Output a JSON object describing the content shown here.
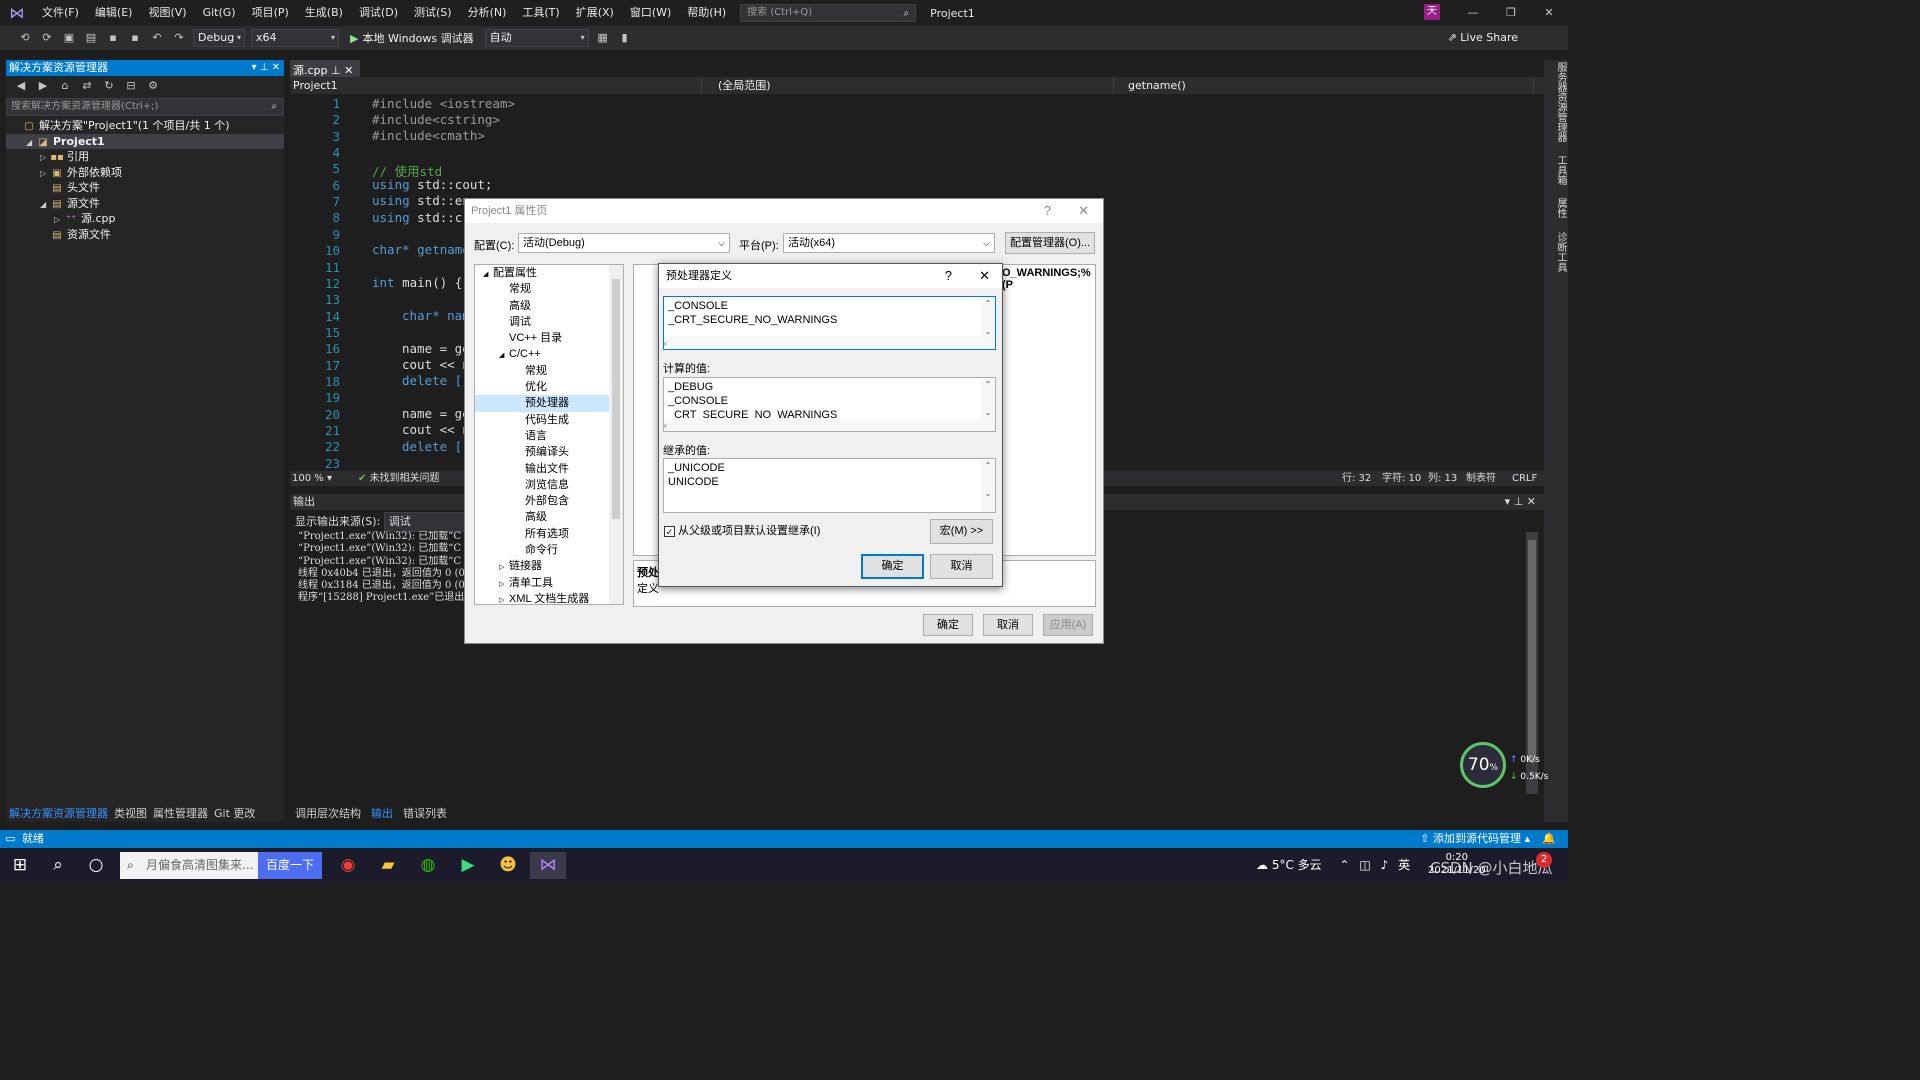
{
  "titlebar": {
    "menu": [
      "文件(F)",
      "编辑(E)",
      "视图(V)",
      "Git(G)",
      "项目(P)",
      "生成(B)",
      "调试(D)",
      "测试(S)",
      "分析(N)",
      "工具(T)",
      "扩展(X)",
      "窗口(W)",
      "帮助(H)"
    ],
    "search_placeholder": "搜索 (Ctrl+Q)",
    "project": "Project1",
    "avatar": "天",
    "win_min": "—",
    "win_max": "❐",
    "win_close": "✕"
  },
  "toolbar": {
    "config": "Debug",
    "platform": "x64",
    "run": "本地 Windows 调试器",
    "auto": "自动",
    "liveshare": "Live Share"
  },
  "solution": {
    "title": "解决方案资源管理器",
    "search_placeholder": "搜索解决方案资源管理器(Ctrl+;)",
    "items": [
      {
        "label": "解决方案\"Project1\"(1 个项目/共 1 个)",
        "depth": 0,
        "arrow": ""
      },
      {
        "label": "Project1",
        "depth": 1,
        "arrow": "◢"
      },
      {
        "label": "引用",
        "depth": 2,
        "arrow": "▷"
      },
      {
        "label": "外部依赖项",
        "depth": 2,
        "arrow": "▷"
      },
      {
        "label": "头文件",
        "depth": 2,
        "arrow": ""
      },
      {
        "label": "源文件",
        "depth": 2,
        "arrow": "◢"
      },
      {
        "label": "源.cpp",
        "depth": 3,
        "arrow": "▷"
      },
      {
        "label": "资源文件",
        "depth": 2,
        "arrow": ""
      }
    ],
    "tabs": [
      "解决方案资源管理器",
      "类视图",
      "属性管理器",
      "Git 更改"
    ]
  },
  "editor": {
    "tab": "源.cpp",
    "nav_project": "Project1",
    "nav_scope": "(全局范围)",
    "nav_func": "getname()",
    "lines": [
      "1",
      "2",
      "3",
      "4",
      "5",
      "6",
      "7",
      "8",
      "9",
      "10",
      "11",
      "12",
      "13",
      "14",
      "15",
      "16",
      "17",
      "18",
      "19",
      "20",
      "21",
      "22",
      "23"
    ],
    "code": {
      "l1": "#include <iostream>",
      "l2": "#include<cstring>",
      "l3": "#include<cmath>",
      "l5": "// 使用std",
      "l6a": "using",
      "l6b": " std::cout;",
      "l7a": "using",
      "l7b": " std::en",
      "l8a": "using",
      "l8b": " std::c",
      "l10": "char* getname",
      "l12a": "int",
      "l12b": " main() {",
      "l14": "char* nam",
      "l16": "name = ge",
      "l17": "cout << n",
      "l18": "delete [",
      "l20": "name = ge",
      "l21": "cout << n",
      "l22": "delete ["
    },
    "zoom": "100 %",
    "issues": "未找到相关问题",
    "status_line": "行: 32",
    "status_char": "字符: 10",
    "status_col": "列: 13",
    "status_tab": "制表符",
    "status_eol": "CRLF"
  },
  "output": {
    "title": "输出",
    "source_label": "显示输出来源(S):",
    "source_value": "调试",
    "lines": [
      "“Project1.exe”(Win32): 已加载“C",
      "“Project1.exe”(Win32): 已加载“C",
      "“Project1.exe”(Win32): 已加载“C",
      "线程 0x40b4 已退出，返回值为 0 (0x",
      "线程 0x3184 已退出，返回值为 0 (0x",
      "程序“[15288] Project1.exe”已退出"
    ],
    "tabs": [
      "调用层次结构",
      "输出",
      "错误列表"
    ]
  },
  "rail": [
    "服务器资源管理器",
    "工具箱",
    "属性",
    "诊断工具"
  ],
  "statusbar": {
    "left": "就绪",
    "right": "添加到源代码管理"
  },
  "prop_dialog": {
    "title": "Project1 属性页",
    "help": "?",
    "close": "✕",
    "config_label": "配置(C):",
    "config_value": "活动(Debug)",
    "platform_label": "平台(P):",
    "platform_value": "活动(x64)",
    "config_mgr": "配置管理器(O)...",
    "tree": [
      {
        "label": "配置属性",
        "depth": 0,
        "arrow": "◢"
      },
      {
        "label": "常规",
        "depth": 1,
        "arrow": ""
      },
      {
        "label": "高级",
        "depth": 1,
        "arrow": ""
      },
      {
        "label": "调试",
        "depth": 1,
        "arrow": ""
      },
      {
        "label": "VC++ 目录",
        "depth": 1,
        "arrow": ""
      },
      {
        "label": "C/C++",
        "depth": 1,
        "arrow": "◢"
      },
      {
        "label": "常规",
        "depth": 2,
        "arrow": ""
      },
      {
        "label": "优化",
        "depth": 2,
        "arrow": ""
      },
      {
        "label": "预处理器",
        "depth": 2,
        "arrow": ""
      },
      {
        "label": "代码生成",
        "depth": 2,
        "arrow": ""
      },
      {
        "label": "语言",
        "depth": 2,
        "arrow": ""
      },
      {
        "label": "预编译头",
        "depth": 2,
        "arrow": ""
      },
      {
        "label": "输出文件",
        "depth": 2,
        "arrow": ""
      },
      {
        "label": "浏览信息",
        "depth": 2,
        "arrow": ""
      },
      {
        "label": "外部包含",
        "depth": 2,
        "arrow": ""
      },
      {
        "label": "高级",
        "depth": 2,
        "arrow": ""
      },
      {
        "label": "所有选项",
        "depth": 2,
        "arrow": ""
      },
      {
        "label": "命令行",
        "depth": 2,
        "arrow": ""
      },
      {
        "label": "链接器",
        "depth": 1,
        "arrow": "▷"
      },
      {
        "label": "清单工具",
        "depth": 1,
        "arrow": "▷"
      },
      {
        "label": "XML 文档生成器",
        "depth": 1,
        "arrow": "▷"
      }
    ],
    "right_snippet": "O_WARNINGS;%(P",
    "desc_title": "预处",
    "desc_text": "定义",
    "ok": "确定",
    "cancel": "取消",
    "apply": "应用(A)"
  },
  "pp_dialog": {
    "title": "预处理器定义",
    "help": "?",
    "close": "✕",
    "defs": [
      "_CONSOLE",
      "_CRT_SECURE_NO_WARNINGS"
    ],
    "computed_label": "计算的值:",
    "computed": [
      "_DEBUG",
      "_CONSOLE",
      "_CRT_SECURE_NO_WARNINGS"
    ],
    "inherited_label": "继承的值:",
    "inherited": [
      "_UNICODE",
      "UNICODE"
    ],
    "inherit_check": "从父级或项目默认设置继承(I)",
    "inherit_checked": true,
    "macros": "宏(M) >>",
    "ok": "确定",
    "cancel": "取消"
  },
  "gauge": {
    "value": "70",
    "unit": "%",
    "up": "0K/s",
    "down": "0.5K/s"
  },
  "taskbar": {
    "search_placeholder": "月偏食高清图集来...",
    "baidu": "百度一下",
    "weather": "5°C 多云",
    "ime": "英",
    "watermark": "CSDN @小白地瓜",
    "time": "0:20",
    "date": "2021/11/20",
    "badge": "2"
  }
}
